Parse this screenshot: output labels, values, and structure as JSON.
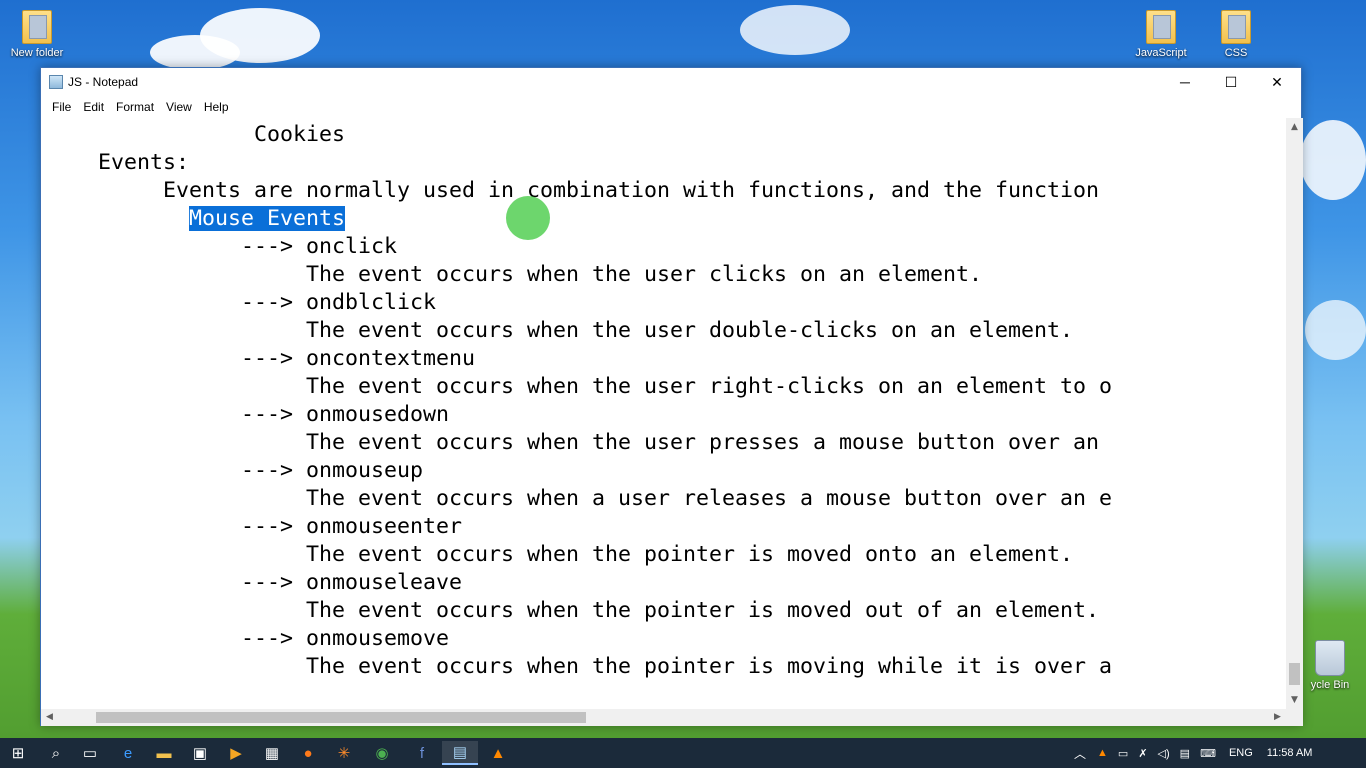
{
  "desktop": {
    "icons": [
      {
        "label": "New folder"
      },
      {
        "label": "JavaScript"
      },
      {
        "label": "CSS"
      },
      {
        "label": "ycle Bin"
      }
    ]
  },
  "window": {
    "title": "JS - Notepad",
    "menu": [
      {
        "label": "File"
      },
      {
        "label": "Edit"
      },
      {
        "label": "Format"
      },
      {
        "label": "View"
      },
      {
        "label": "Help"
      }
    ],
    "buttons": {
      "minimize": "─",
      "maximize": "☐",
      "close": "✕"
    }
  },
  "editor": {
    "lines": [
      {
        "text": "                Cookies"
      },
      {
        "text": "    Events:"
      },
      {
        "text": "         Events are normally used in combination with functions, and the function"
      },
      {
        "text": "           ",
        "selected": "Mouse Events",
        "after": ""
      },
      {
        "text": "               ---> onclick"
      },
      {
        "text": "                    The event occurs when the user clicks on an element."
      },
      {
        "text": "               ---> ondblclick"
      },
      {
        "text": "                    The event occurs when the user double-clicks on an element."
      },
      {
        "text": "               ---> oncontextmenu"
      },
      {
        "text": "                    The event occurs when the user right-clicks on an element to o"
      },
      {
        "text": "               ---> onmousedown"
      },
      {
        "text": "                    The event occurs when the user presses a mouse button over an"
      },
      {
        "text": "               ---> onmouseup"
      },
      {
        "text": "                    The event occurs when a user releases a mouse button over an e"
      },
      {
        "text": "               ---> onmouseenter"
      },
      {
        "text": "                    The event occurs when the pointer is moved onto an element."
      },
      {
        "text": "               ---> onmouseleave"
      },
      {
        "text": "                    The event occurs when the pointer is moved out of an element."
      },
      {
        "text": "               ---> onmousemove"
      },
      {
        "text": "                    The event occurs when the pointer is moving while it is over a"
      }
    ]
  },
  "taskbar": {
    "tray": {
      "language": "ENG",
      "time": "11:58 AM"
    }
  },
  "colors": {
    "selection": "#0a6fd8",
    "taskbar": "#1b2a3a"
  }
}
